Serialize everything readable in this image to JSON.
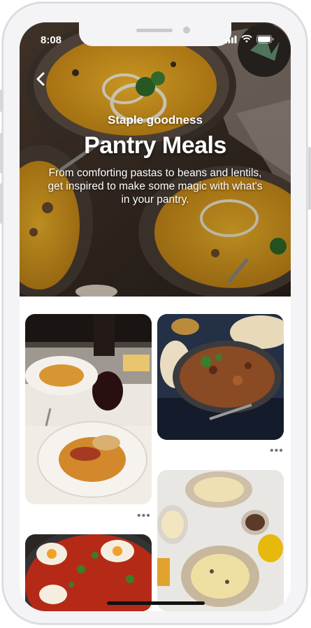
{
  "status_bar": {
    "time": "8:08"
  },
  "hero": {
    "subtitle": "Staple goodness",
    "title": "Pantry Meals",
    "description": "From comforting pastas to beans and lentils, get inspired to make some magic with what's in your pantry."
  },
  "pins": [
    {
      "name": "pasta-ragu-pin",
      "more_label": "•••"
    },
    {
      "name": "lentil-stew-pin",
      "more_label": "•••"
    },
    {
      "name": "spaghetti-carbonara-pin",
      "more_label": "•••"
    },
    {
      "name": "shakshuka-pin",
      "more_label": "•••"
    }
  ],
  "icons": [
    "chevron-left-icon",
    "signal-icon",
    "wifi-icon",
    "battery-icon"
  ]
}
